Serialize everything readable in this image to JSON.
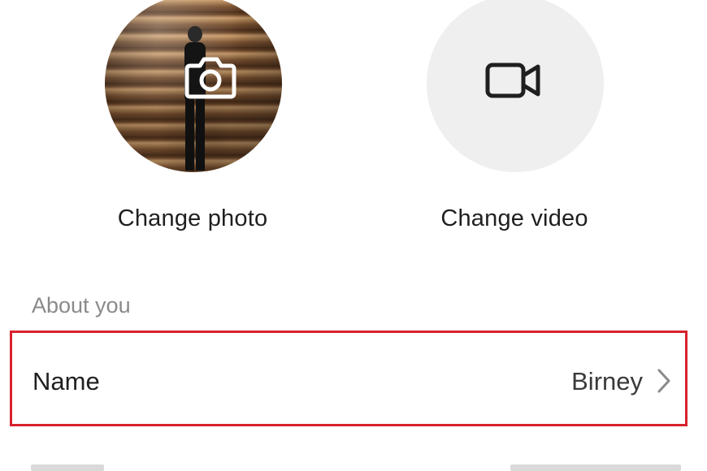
{
  "media": {
    "photo_label": "Change photo",
    "video_label": "Change video",
    "photo_icon": "camera-icon",
    "video_icon": "video-camera-icon"
  },
  "about": {
    "section_title": "About you",
    "name_row": {
      "label": "Name",
      "value": "Birney",
      "chevron_icon": "chevron-right-icon",
      "highlight_color": "#d7222c"
    }
  }
}
